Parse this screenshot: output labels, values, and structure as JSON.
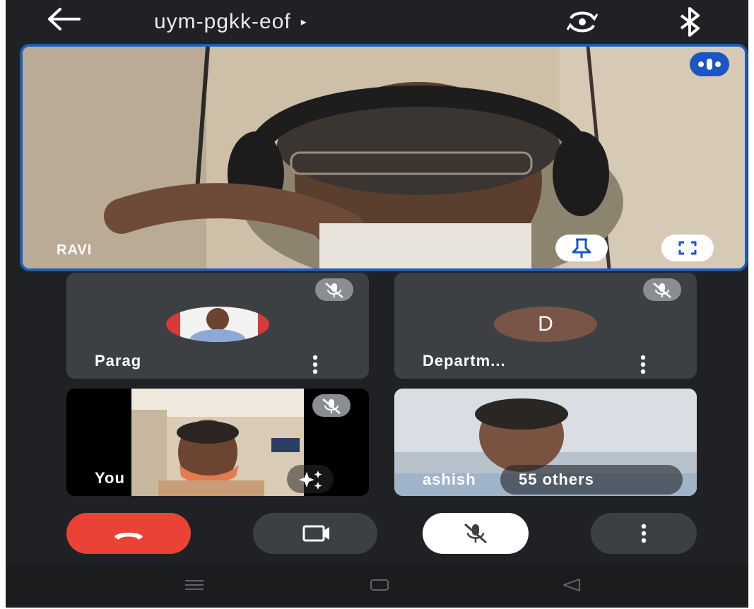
{
  "header": {
    "back_icon": "arrow-left-icon",
    "meeting_code": "uym-pgkk-eof",
    "caret_glyph": "▸",
    "switch_camera_icon": "switch-camera-icon",
    "bluetooth_icon": "bluetooth-icon"
  },
  "main_tile": {
    "participant_name": "RAVI",
    "speaking_icon": "speaking-indicator-icon",
    "pin_icon": "pin-icon",
    "fullscreen_icon": "fullscreen-icon"
  },
  "tiles": [
    {
      "name": "Parag",
      "muted": true,
      "avatar": "photo",
      "more_icon": "more-vert-icon"
    },
    {
      "name": "Departm...",
      "muted": true,
      "avatar_letter": "D",
      "more_icon": "more-vert-icon"
    },
    {
      "name": "You",
      "muted": true,
      "effects_icon": "sparkle-effects-icon"
    },
    {
      "name": "ashish",
      "overlay": "55 others"
    }
  ],
  "controls": {
    "end_call_icon": "end-call-icon",
    "camera_icon": "video-camera-icon",
    "mic_icon": "mic-off-icon",
    "more_icon": "more-vert-icon"
  },
  "nav": {
    "recents_icon": "recents-icon",
    "home_icon": "home-icon",
    "back_icon": "nav-back-icon"
  },
  "colors": {
    "background": "#202124",
    "tile": "#3c4043",
    "active_border": "#1a5fb4",
    "end_call": "#ea4335",
    "mute_badge": "#8a8d91"
  }
}
